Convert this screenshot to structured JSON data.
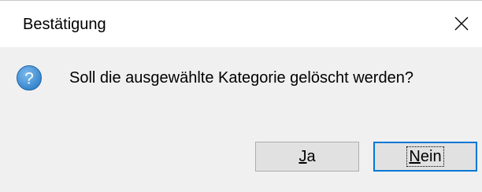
{
  "dialog": {
    "title": "Bestätigung",
    "message": "Soll die ausgewählte Kategorie gelöscht werden?",
    "icon": "question-icon",
    "close_glyph": "close-icon",
    "buttons": {
      "yes": {
        "mnemonic": "J",
        "rest": "a"
      },
      "no": {
        "mnemonic": "N",
        "rest": "ein"
      }
    },
    "default_button": "no",
    "colors": {
      "icon_fill": "#3c8fd6",
      "focus_border": "#0078d7",
      "button_bg": "#e1e1e1",
      "titlebar_bg": "#ffffff",
      "body_bg": "#f0f0f0"
    }
  }
}
